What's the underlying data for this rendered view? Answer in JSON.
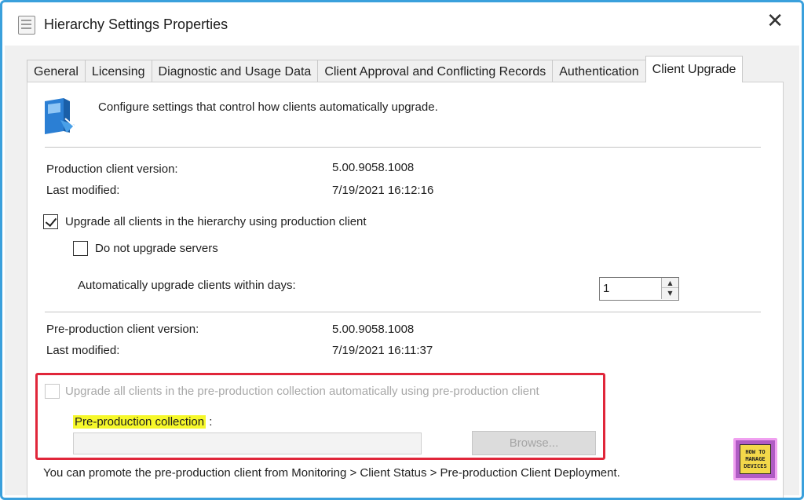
{
  "window": {
    "title": "Hierarchy Settings Properties",
    "close_glyph": "✕"
  },
  "tabs": [
    {
      "label": "General",
      "active": false
    },
    {
      "label": "Licensing",
      "active": false
    },
    {
      "label": "Diagnostic and Usage Data",
      "active": false
    },
    {
      "label": "Client Approval and Conflicting Records",
      "active": false
    },
    {
      "label": "Authentication",
      "active": false
    },
    {
      "label": "Client Upgrade",
      "active": true
    }
  ],
  "panel": {
    "intro": "Configure settings that control how clients automatically upgrade.",
    "production": {
      "version_label": "Production client version:",
      "version_value": "5.00.9058.1008",
      "modified_label": "Last modified:",
      "modified_value": "7/19/2021 16:12:16"
    },
    "upgrade_all": {
      "label": "Upgrade all clients in the hierarchy using production client",
      "checked": true
    },
    "no_servers": {
      "label": "Do not upgrade servers",
      "checked": false
    },
    "auto_days": {
      "label": "Automatically upgrade clients within days:",
      "value": "1",
      "up_glyph": "▲",
      "down_glyph": "▼"
    },
    "preproduction": {
      "version_label": "Pre-production client version:",
      "version_value": "5.00.9058.1008",
      "modified_label": "Last modified:",
      "modified_value": "7/19/2021 16:11:37"
    },
    "preprod_upgrade": {
      "label": "Upgrade all clients in the pre-production collection automatically using pre-production client",
      "checked": false,
      "enabled": false
    },
    "collection": {
      "label": "Pre-production collection",
      "colon": ":",
      "value": "",
      "browse_label": "Browse..."
    },
    "footer_note": "You can promote the pre-production client from Monitoring > Client Status > Pre-production Client Deployment."
  },
  "watermark": {
    "line1": "HOW TO",
    "line2": "MANAGE",
    "line3": "DEVICES"
  },
  "colors": {
    "window_border": "#3aa0dc",
    "highlight_box": "#e0263a",
    "highlight_marker": "#f6f82a"
  }
}
